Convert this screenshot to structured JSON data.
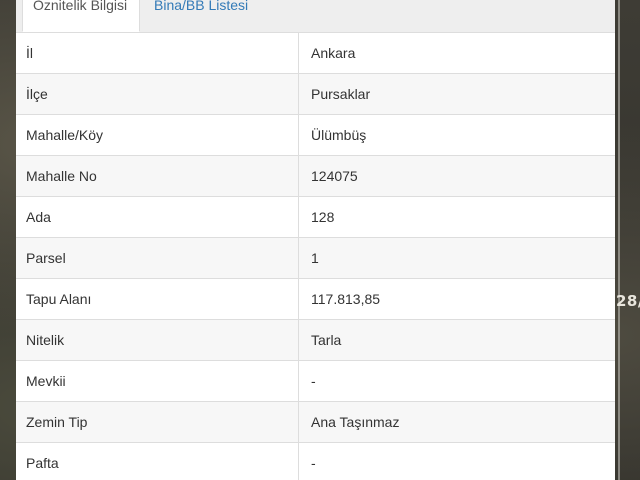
{
  "tabs": [
    {
      "label": "Öznitelik Bilgisi",
      "active": true
    },
    {
      "label": "Bina/BB Listesi",
      "active": false
    }
  ],
  "rows": [
    {
      "key": "İl",
      "value": "Ankara"
    },
    {
      "key": "İlçe",
      "value": "Pursaklar"
    },
    {
      "key": "Mahalle/Köy",
      "value": "Ülümbüş"
    },
    {
      "key": "Mahalle No",
      "value": "124075"
    },
    {
      "key": "Ada",
      "value": "128"
    },
    {
      "key": "Parsel",
      "value": "1"
    },
    {
      "key": "Tapu Alanı",
      "value": "117.813,85"
    },
    {
      "key": "Nitelik",
      "value": "Tarla"
    },
    {
      "key": "Mevkii",
      "value": "-"
    },
    {
      "key": "Zemin Tip",
      "value": "Ana Taşınmaz"
    },
    {
      "key": "Pafta",
      "value": "-"
    }
  ],
  "map": {
    "label": "28/"
  }
}
